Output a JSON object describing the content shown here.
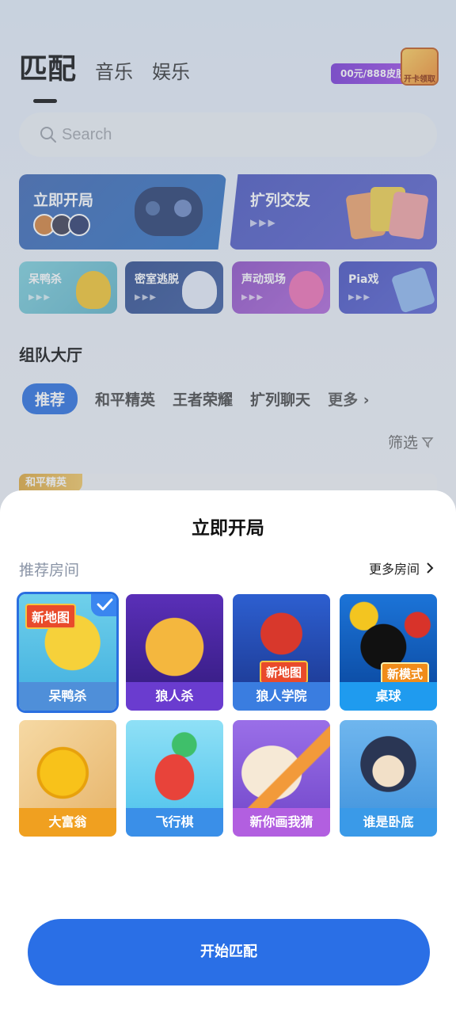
{
  "header": {
    "tabs": [
      {
        "label": "匹配",
        "active": true
      },
      {
        "label": "音乐",
        "active": false
      },
      {
        "label": "娱乐",
        "active": false
      }
    ],
    "promo_text": "00元/888皮肤",
    "promo_box_text": "开卡领取"
  },
  "search": {
    "placeholder": "Search",
    "icon": "search-icon"
  },
  "feature_cards": [
    {
      "title": "立即开局",
      "color": "#3b6cc0"
    },
    {
      "title": "扩列交友",
      "color": "#5560c8"
    }
  ],
  "small_cards": [
    {
      "title": "呆鸭杀",
      "color": "#5fb4c8"
    },
    {
      "title": "密室逃脱",
      "color": "#2f4a8a"
    },
    {
      "title": "声动现场",
      "color": "#9b55c9"
    },
    {
      "title": "Pia戏",
      "color": "#4a56c8"
    }
  ],
  "lobby": {
    "title": "组队大厅",
    "filters": [
      "推荐",
      "和平精英",
      "王者荣耀",
      "扩列聊天"
    ],
    "active_filter": "推荐",
    "more": "更多",
    "filter_button": "筛选",
    "first_room_tag": "和平精英"
  },
  "sheet": {
    "title": "立即开局",
    "section_label": "推荐房间",
    "more_rooms": "更多房间",
    "games": [
      {
        "name": "呆鸭杀",
        "badge": "新地图",
        "selected": true,
        "label_color": "#4f8fd9"
      },
      {
        "name": "狼人杀",
        "badge": "",
        "selected": false,
        "label_color": "#6a3ccf"
      },
      {
        "name": "狼人学院",
        "badge": "新地图",
        "selected": false,
        "label_color": "#3a7de0"
      },
      {
        "name": "桌球",
        "badge": "新模式",
        "selected": false,
        "label_color": "#1f9bef"
      },
      {
        "name": "大富翁",
        "badge": "",
        "selected": false,
        "label_color": "#f0a020"
      },
      {
        "name": "飞行棋",
        "badge": "",
        "selected": false,
        "label_color": "#3a8fe8"
      },
      {
        "name": "新你画我猜",
        "badge": "",
        "selected": false,
        "label_color": "#b25fe0"
      },
      {
        "name": "谁是卧底",
        "badge": "",
        "selected": false,
        "label_color": "#3a9ae8"
      }
    ],
    "start_button": "开始匹配"
  },
  "colors": {
    "accent": "#2a6fe6",
    "sheet_bg": "#ffffff",
    "muted_text": "#8a94a6"
  }
}
